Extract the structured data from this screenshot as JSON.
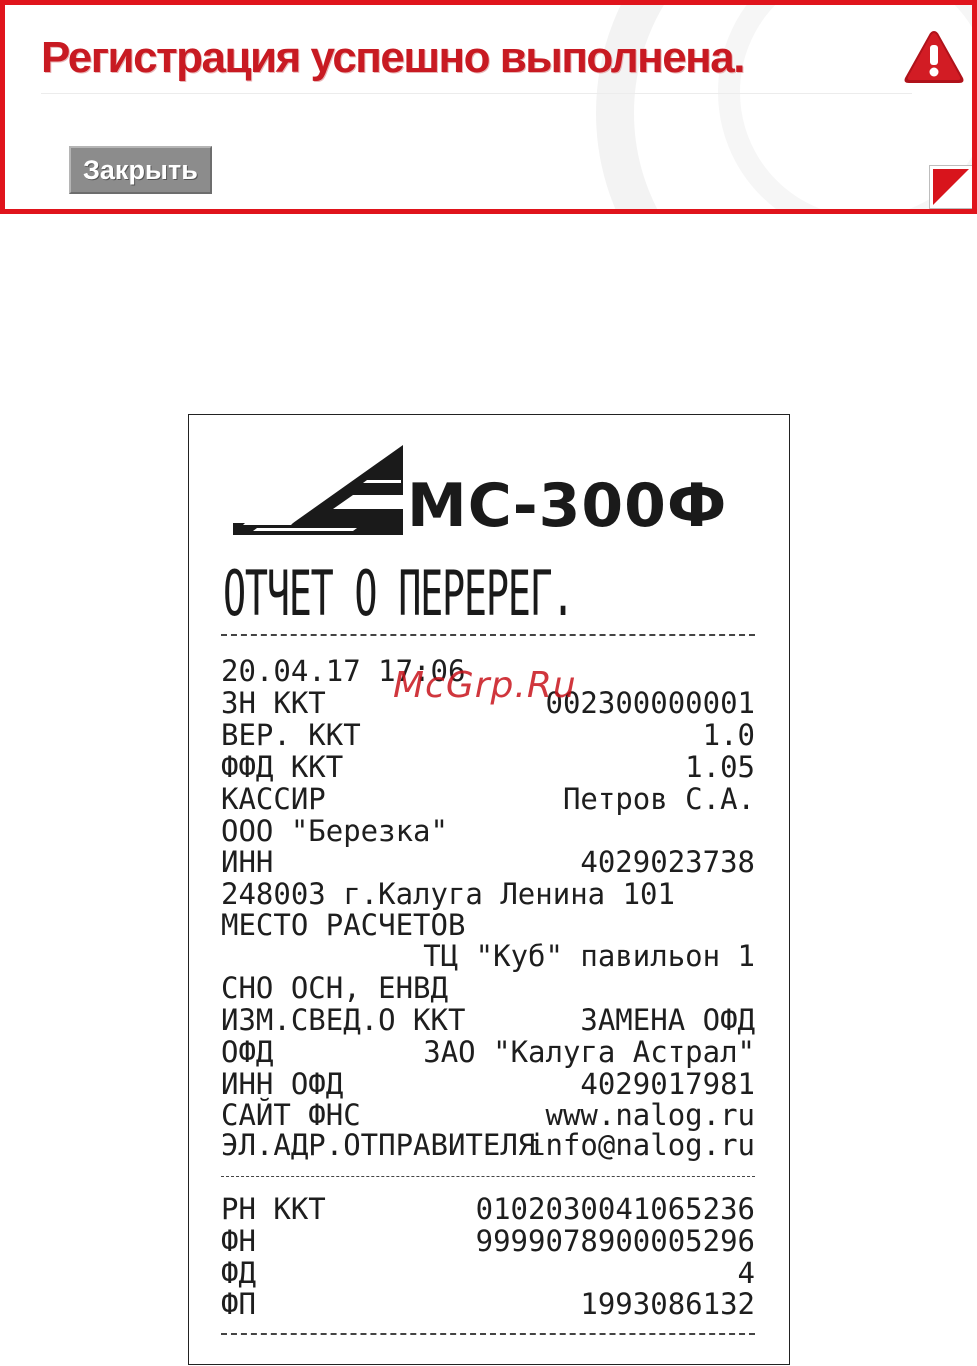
{
  "banner": {
    "title": "Регистрация успешно выполнена.",
    "close_label": "Закрыть",
    "accent": "#e0141c",
    "icon": "warning-icon"
  },
  "receipt": {
    "logo_text": "МС-300Ф",
    "report_title": "ОТЧЕТ О ПЕРЕРЕГ.",
    "datetime": "20.04.17 17:06",
    "rows": [
      {
        "k": "ЗН ККТ",
        "v": "002300000001"
      },
      {
        "k": "ВЕР. ККТ",
        "v": "1.0"
      },
      {
        "k": "ФФД ККТ",
        "v": "1.05"
      },
      {
        "k": "КАССИР",
        "v": "Петров С.А."
      }
    ],
    "org": "ООО \"Березка\"",
    "inn": {
      "k": "ИНН",
      "v": "4029023738"
    },
    "address": "248003 г.Калуга Ленина 101",
    "place_label": "МЕСТО РАСЧЕТОВ",
    "place_value": "ТЦ \"Куб\" павильон 1",
    "sno": "СНО ОСН, ЕНВД",
    "rows2": [
      {
        "k": "ИЗМ.СВЕД.О ККТ",
        "v": "ЗАМЕНА ОФД"
      },
      {
        "k": "ОФД",
        "v": "ЗАО \"Калуга Астрал\""
      },
      {
        "k": "ИНН ОФД",
        "v": "4029017981"
      },
      {
        "k": "САЙТ ФНС",
        "v": "www.nalog.ru"
      },
      {
        "k": "ЭЛ.АДР.ОТПРАВИТЕЛЯ",
        "v": "info@nalog.ru"
      }
    ],
    "rows3": [
      {
        "k": "РН ККТ",
        "v": "0102030041065236"
      },
      {
        "k": "ФН",
        "v": "9999078900005296"
      },
      {
        "k": "ФД",
        "v": "4"
      },
      {
        "k": "ФП",
        "v": "1993086132"
      }
    ]
  },
  "watermark": "McGrp.Ru"
}
